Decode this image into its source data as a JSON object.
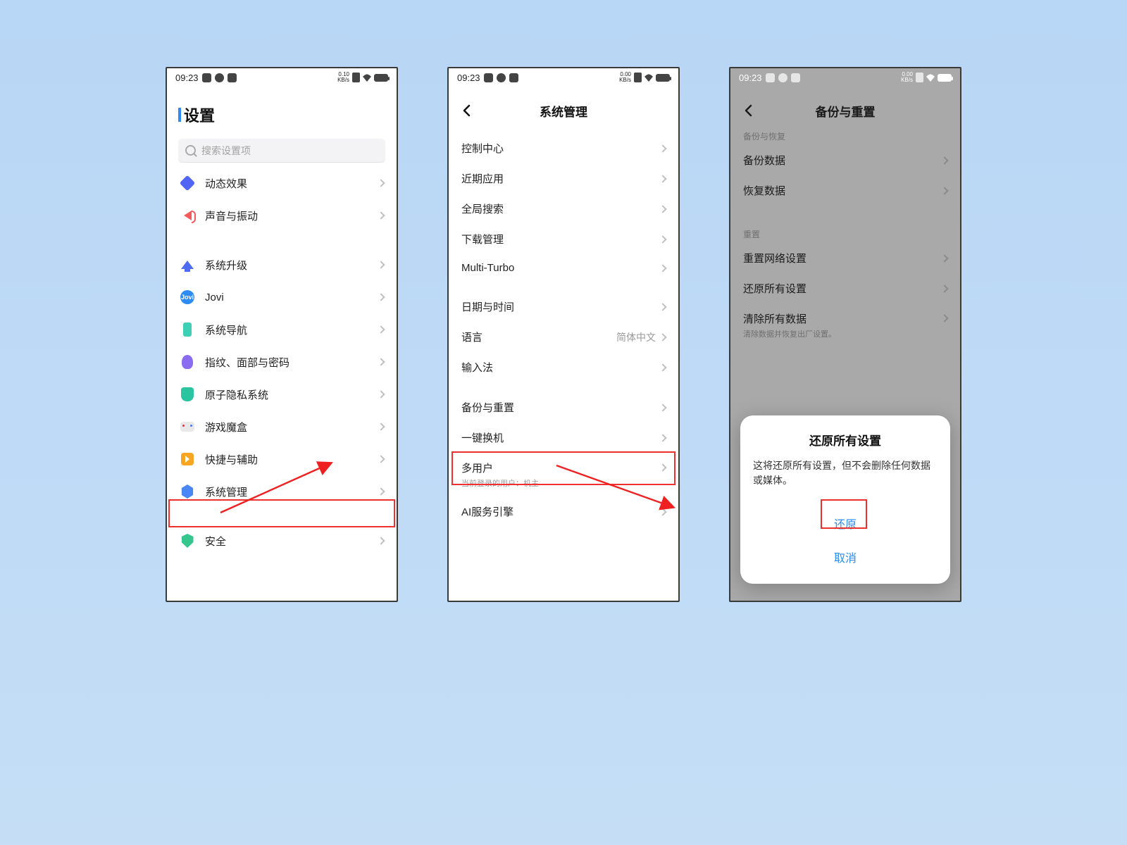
{
  "status": {
    "time": "09:23",
    "net_p1": "0.10",
    "net_p3": "0.00",
    "kbs": "KB/s"
  },
  "screen1": {
    "title": "设置",
    "search_placeholder": "搜索设置项",
    "items": {
      "dynamic": "动态效果",
      "sound": "声音与振动",
      "upgrade": "系统升级",
      "jovi": "Jovi",
      "nav": "系统导航",
      "fp": "指纹、面部与密码",
      "privacy": "原子隐私系统",
      "game": "游戏魔盒",
      "quick": "快捷与辅助",
      "sysmgmt": "系统管理",
      "security": "安全"
    }
  },
  "screen2": {
    "title": "系统管理",
    "items": {
      "control": "控制中心",
      "recent": "近期应用",
      "global_search": "全局搜索",
      "download": "下载管理",
      "multiturbo": "Multi-Turbo",
      "datetime": "日期与时间",
      "language": "语言",
      "language_value": "简体中文",
      "ime": "输入法",
      "backup_reset": "备份与重置",
      "one_switch": "一键换机",
      "multiuser": "多用户",
      "multiuser_sub": "当前登录的用户：机主",
      "ai": "AI服务引擎"
    }
  },
  "screen3": {
    "title": "备份与重置",
    "section_backup": "备份与恢复",
    "backup_data": "备份数据",
    "restore_data": "恢复数据",
    "section_reset": "重置",
    "reset_network": "重置网络设置",
    "restore_all_settings": "还原所有设置",
    "clear_all": "清除所有数据",
    "clear_all_sub": "清除数据并恢复出厂设置。",
    "dialog": {
      "title": "还原所有设置",
      "body": "这将还原所有设置，但不会删除任何数据或媒体。",
      "confirm": "还原",
      "cancel": "取消"
    }
  },
  "jovi_badge": "Jovi"
}
